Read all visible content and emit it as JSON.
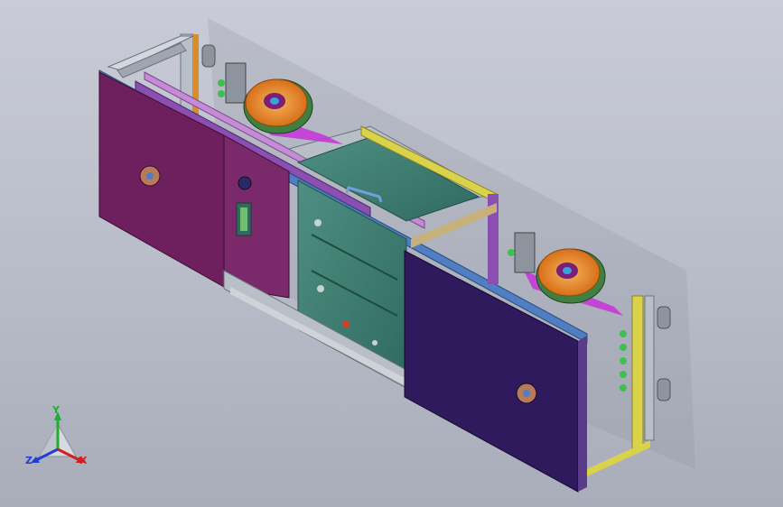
{
  "viewport": {
    "background_top": "#c9ccd6",
    "background_bottom": "#a9adb9"
  },
  "model": {
    "colors": {
      "door_left": "#6e1f5e",
      "door_right": "#2e1a5c",
      "frame_silver": "#b9bfc7",
      "rail_blue": "#4f7fc2",
      "rail_purple": "#8a4fb0",
      "housing_teal": "#3f7f73",
      "fan_orange": "#e8892a",
      "fan_hub": "#7a1f78",
      "plate_magenta": "#c43ad8",
      "rail_yellow": "#d9d24a",
      "accent_green": "#3fbf4f"
    }
  },
  "triad": {
    "x_label": "X",
    "y_label": "Y",
    "z_label": "Z",
    "x_color": "#d21f1f",
    "y_color": "#1fae2f",
    "z_color": "#1f3fd2"
  }
}
